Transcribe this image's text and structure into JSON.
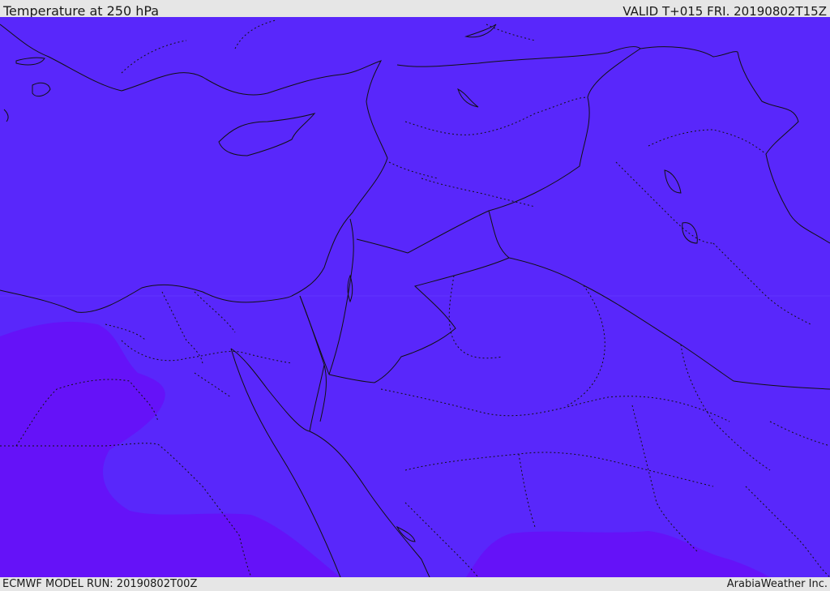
{
  "header": {
    "title": "Temperature at 250 hPa",
    "valid": "VALID T+015 FRI. 20190802T15Z"
  },
  "footer": {
    "model_run": "ECMWF MODEL RUN: 20190802T00Z",
    "credit": "ArabiaWeather Inc."
  },
  "colors": {
    "field_main": "#5927fb",
    "field_warm": "#6512f8",
    "borders": "#111111",
    "bar_bg": "#e6e6e6"
  }
}
